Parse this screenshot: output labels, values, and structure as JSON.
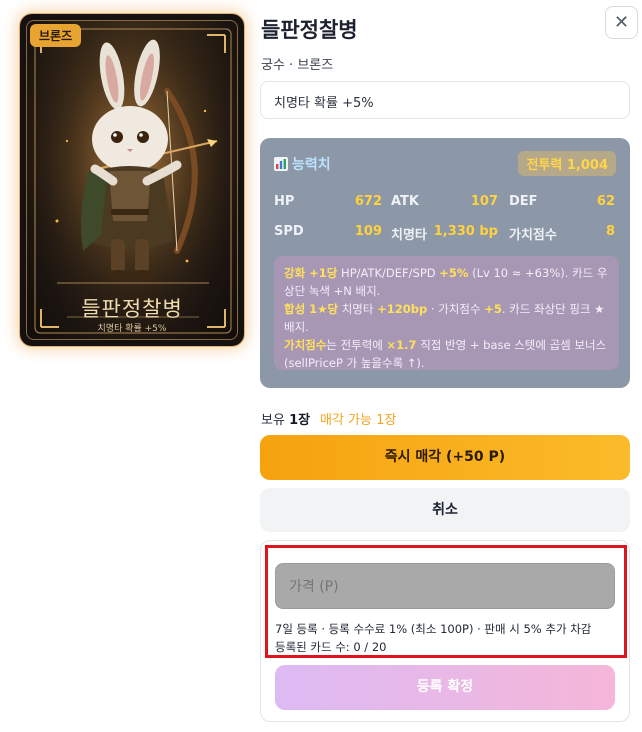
{
  "card": {
    "rarity_badge": "브론즈",
    "art_title": "들판정찰병",
    "art_subtitle": "치명타 확률 +5%"
  },
  "header": {
    "title": "들판정찰병",
    "subtitle": "궁수 · 브론즈",
    "close_label": "✕"
  },
  "effect": {
    "text": "치명타 확률 +5%"
  },
  "stats": {
    "heading": "능력치",
    "power_label": "전투력 1,004",
    "rows": [
      {
        "key": "HP",
        "value": "672"
      },
      {
        "key": "ATK",
        "value": "107"
      },
      {
        "key": "DEF",
        "value": "62"
      },
      {
        "key": "SPD",
        "value": "109"
      },
      {
        "key": "치명타",
        "value": "1,330 bp"
      },
      {
        "key": "가치점수",
        "value": "8"
      }
    ],
    "notes": {
      "line1_hl": "강화 +1당",
      "line1_a": " HP/ATK/DEF/SPD ",
      "line1_hl2": "+5%",
      "line1_b": " (Lv 10 ≈ +63%). 카드 우상단 녹색 +N 배지.",
      "line2_hl": "합성 1★당",
      "line2_a": " 치명타 ",
      "line2_hl2": "+120bp",
      "line2_b": " · 가치점수 ",
      "line2_hl3": "+5",
      "line2_c": ". 카드 좌상단 핑크 ★ 배지.",
      "line3_hl": "가치점수",
      "line3_a": "는 전투력에 ",
      "line3_hl2": "×1.7",
      "line3_b": " 직접 반영 + base 스텟에 곱셈 보너스 (sellPriceP 가 높을수록 ↑)."
    }
  },
  "inventory": {
    "owned_prefix": "보유 ",
    "owned_count": "1장",
    "sellable": "매각 가능 1장"
  },
  "actions": {
    "sell_now": "즉시 매각 (+50 P)",
    "cancel": "취소"
  },
  "listing": {
    "price_placeholder": "가격 (P)",
    "fee_note": "7일 등록 · 등록 수수료 1% (최소 100P) · 판매 시 5% 추가 차감",
    "count_note": "등록된 카드 수: 0 / 20",
    "confirm": "등록 확정"
  },
  "colors": {
    "sell_button": "#f6a20f",
    "highlight_frame": "#e0141e",
    "stat_value": "#ffd23f",
    "rarity_badge": "#e7a431"
  }
}
